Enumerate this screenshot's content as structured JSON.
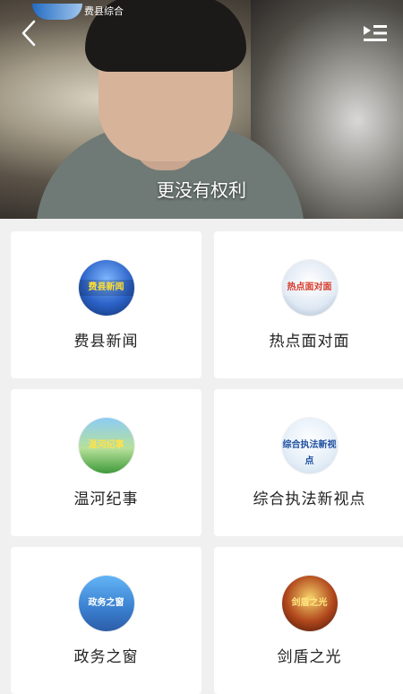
{
  "video": {
    "subtitle": "更没有权利",
    "channel_logo_text": "费县综合",
    "icons": {
      "back": "chevron-left-icon",
      "playlist": "playlist-icon"
    }
  },
  "programs": [
    {
      "label": "费县新闻",
      "thumb_text": "费县新闻",
      "icon": "program-thumb-icon"
    },
    {
      "label": "热点面对面",
      "thumb_text": "热点面对面",
      "icon": "program-thumb-icon"
    },
    {
      "label": "温河纪事",
      "thumb_text": "温河纪事",
      "icon": "program-thumb-icon"
    },
    {
      "label": "综合执法新视点",
      "thumb_text": "综合执法新视点",
      "icon": "program-thumb-icon"
    },
    {
      "label": "政务之窗",
      "thumb_text": "政务之窗",
      "icon": "program-thumb-icon"
    },
    {
      "label": "剑盾之光",
      "thumb_text": "剑盾之光",
      "icon": "program-thumb-icon"
    }
  ],
  "colors": {
    "page_background": "#f0f0f0",
    "card_background": "#ffffff",
    "text": "#222222"
  }
}
